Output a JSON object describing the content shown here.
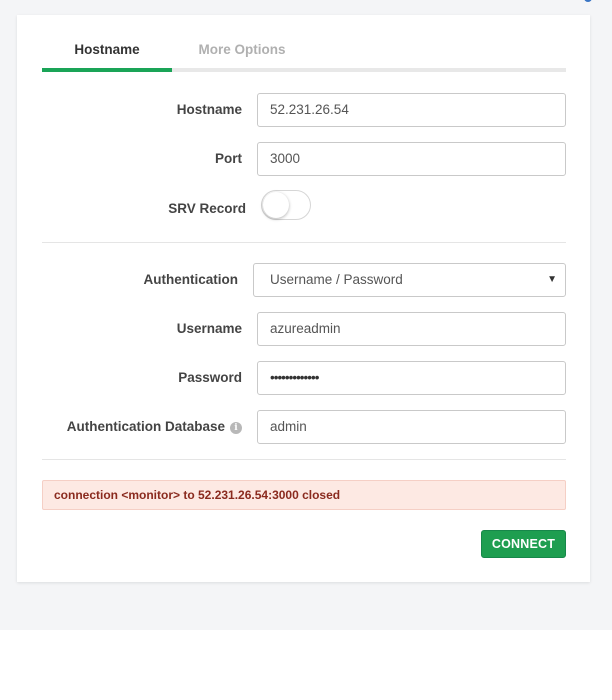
{
  "tabs": [
    {
      "label": "Hostname",
      "active": true
    },
    {
      "label": "More Options",
      "active": false
    }
  ],
  "form": {
    "hostname": {
      "label": "Hostname",
      "value": "52.231.26.54"
    },
    "port": {
      "label": "Port",
      "value": "3000"
    },
    "srv_record": {
      "label": "SRV Record",
      "enabled": false
    },
    "authentication": {
      "label": "Authentication",
      "selected": "Username / Password"
    },
    "username": {
      "label": "Username",
      "value": "azureadmin"
    },
    "password": {
      "label": "Password",
      "masked_value": "•••••••••••••"
    },
    "auth_database": {
      "label": "Authentication Database",
      "value": "admin",
      "info_icon": "info-icon"
    }
  },
  "error": {
    "message": "connection <monitor> to 52.231.26.54:3000 closed"
  },
  "actions": {
    "connect_label": "CONNECT"
  },
  "colors": {
    "accent": "#1aa457",
    "button": "#1e9e50",
    "error_bg": "#fde9e3",
    "error_text": "#8a2a1e"
  }
}
